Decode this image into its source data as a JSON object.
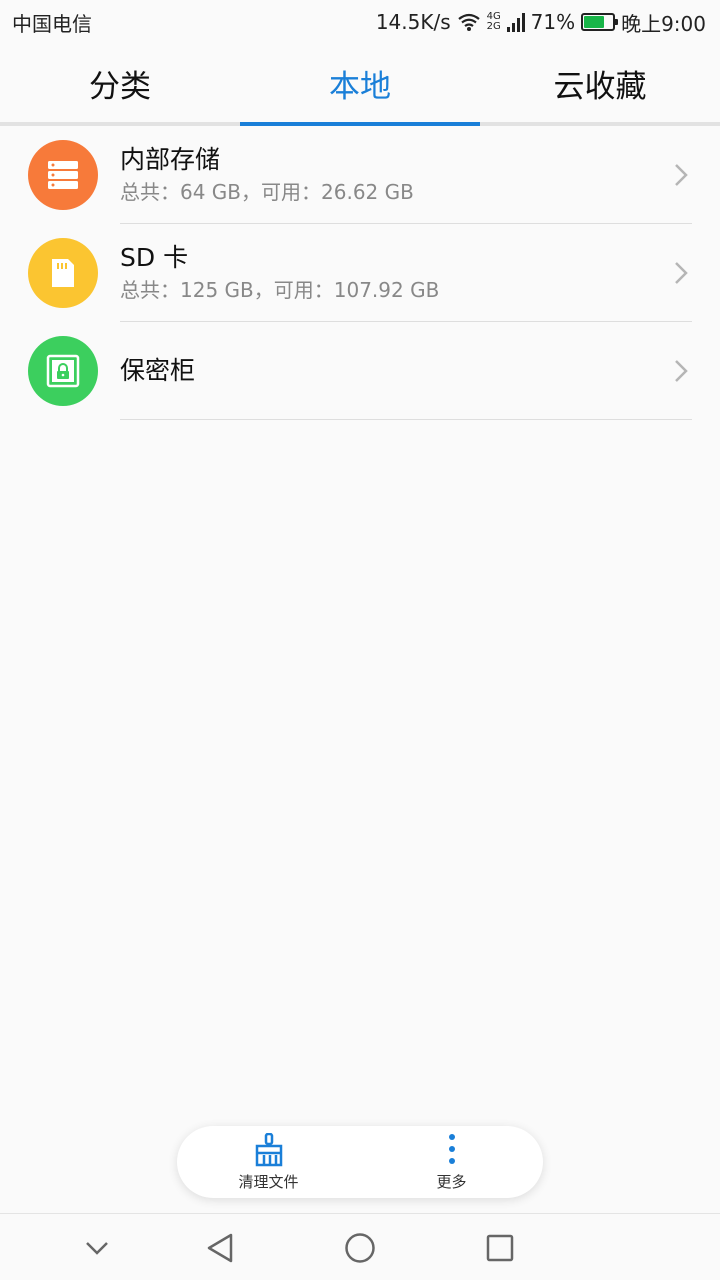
{
  "status_bar": {
    "carrier": "中国电信",
    "network_speed": "14.5K/s",
    "signal_tech_top": "4G",
    "signal_tech_bottom": "2G",
    "battery_percent_text": "71%",
    "battery_level": 0.71,
    "time": "晚上9:00"
  },
  "tabs": [
    {
      "label": "分类",
      "active": false
    },
    {
      "label": "本地",
      "active": true
    },
    {
      "label": "云收藏",
      "active": false
    }
  ],
  "storage_items": [
    {
      "title": "内部存储",
      "subtitle": "总共：64 GB，可用：26.62 GB",
      "icon": "storage-server-icon",
      "color": "#f77a3a"
    },
    {
      "title": "SD 卡",
      "subtitle": "总共：125 GB，可用：107.92 GB",
      "icon": "sd-card-icon",
      "color": "#fbc531"
    },
    {
      "title": "保密柜",
      "subtitle": "",
      "icon": "safe-lock-icon",
      "color": "#3ccf5e"
    }
  ],
  "toolbar": {
    "clean_label": "清理文件",
    "more_label": "更多"
  },
  "colors": {
    "accent": "#1a7fd8",
    "divider": "#dedede",
    "background": "#fafafa"
  }
}
